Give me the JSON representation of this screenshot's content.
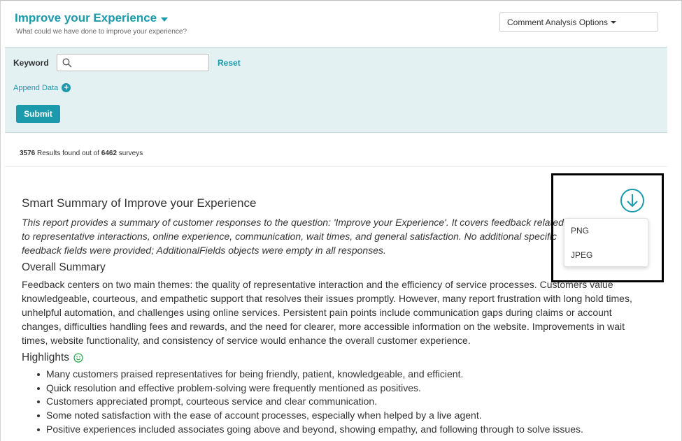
{
  "header": {
    "title": "Improve your Experience",
    "subtitle": "What could we have done to improve your experience?",
    "options_button": "Comment Analysis Options"
  },
  "filter": {
    "keyword_label": "Keyword",
    "search_value": "",
    "reset_label": "Reset",
    "append_label": "Append Data",
    "submit_label": "Submit"
  },
  "results": {
    "found": "3576",
    "text_mid": " Results found out of ",
    "total": "6462",
    "text_end": " surveys"
  },
  "summary": {
    "title": "Smart Summary of Improve your Experience",
    "intro": "This report provides a summary of customer responses to the question: 'Improve your Experience'. It covers feedback related to representative interactions, online experience, communication, wait times, and general satisfaction. No additional specific feedback fields were provided; AdditionalFields objects were empty in all responses.",
    "overall_heading": "Overall Summary",
    "overall_text": "Feedback centers on two main themes: the quality of representative interaction and the efficiency of service processes. Customers value knowledgeable, courteous, and empathetic support that resolves their issues promptly. However, many report frustration with long hold times, unhelpful automation, and challenges using online services. Persistent pain points include communication gaps during claims or account changes, difficulties handling fees and rewards, and the need for clearer, more accessible information on the website. Improvements in wait times, website functionality, and consistency of service would enhance the overall customer experience.",
    "highlights_heading": "Highlights",
    "highlights": [
      "Many customers praised representatives for being friendly, patient, knowledgeable, and efficient.",
      "Quick resolution and effective problem-solving were frequently mentioned as positives.",
      "Customers appreciated prompt, courteous service and clear communication.",
      "Some noted satisfaction with the ease of account processes, especially when helped by a live agent.",
      "Positive experiences included associates going above and beyond, showing empathy, and following through to solve issues."
    ]
  },
  "download_menu": {
    "items": [
      "PNG",
      "JPEG"
    ]
  },
  "colors": {
    "accent": "#1a9aaa",
    "filter_bg": "#e4f1f3",
    "smile": "#2fa84f"
  },
  "icons": {
    "download": "download-circle-icon",
    "search": "search-icon",
    "append": "plus-circle-icon",
    "highlights": "smile-icon"
  }
}
